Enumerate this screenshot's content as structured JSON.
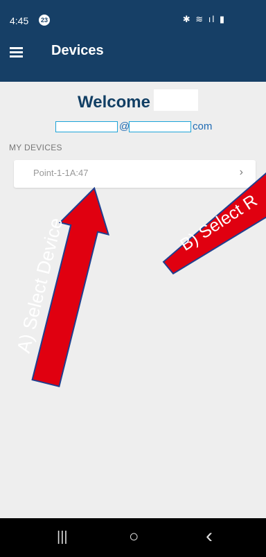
{
  "status": {
    "time": "4:45",
    "badge": "23",
    "icons": "✱ ≋ ıl ▮"
  },
  "appbar": {
    "title": "Devices"
  },
  "welcome": {
    "text": "Welcome",
    "email_at": "@",
    "email_suffix": "com"
  },
  "section": {
    "label": "MY DEVICES"
  },
  "device": {
    "name": "Point-1-1A:47"
  },
  "annotations": {
    "a": "A) Select Device",
    "b": "B) Select R"
  },
  "nav": {
    "recent": "|||",
    "home": "○",
    "back": "‹"
  }
}
